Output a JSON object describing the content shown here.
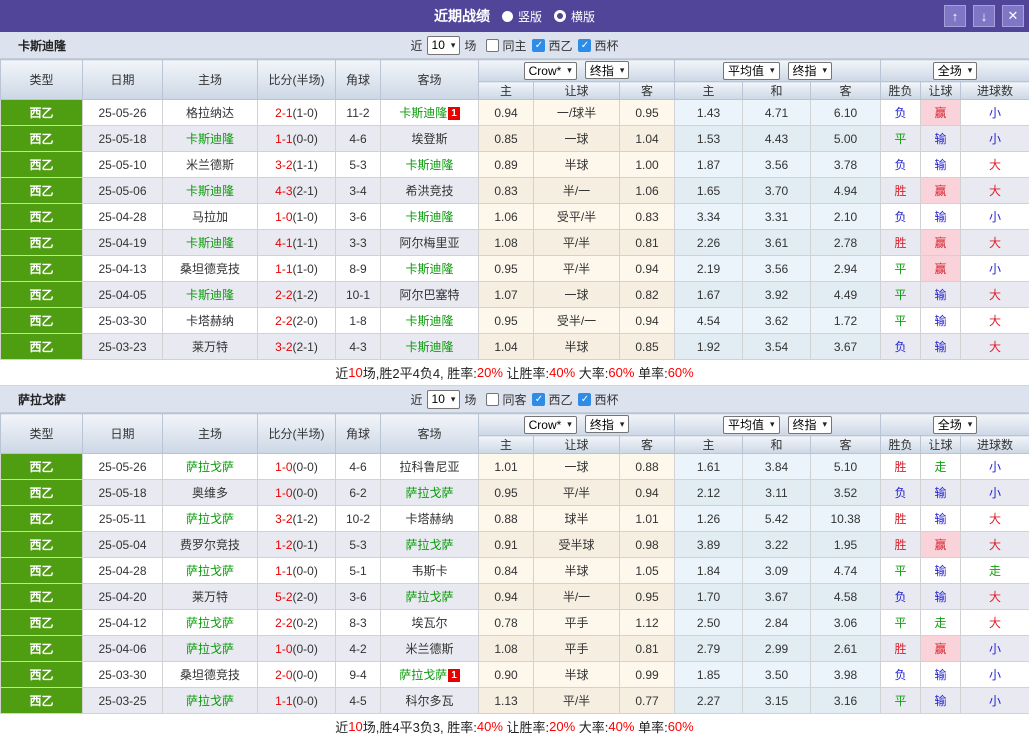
{
  "titlebar": {
    "title": "近期战绩",
    "radio_vertical": "竖版",
    "radio_horizontal": "横版"
  },
  "filter_labels": {
    "near": "近",
    "matches": "场",
    "league": "西乙",
    "cup": "西杯"
  },
  "columns": {
    "type": "类型",
    "date": "日期",
    "home": "主场",
    "score": "比分(半场)",
    "corner": "角球",
    "away": "客场",
    "crow_dropdown": "Crow*",
    "final_dropdown": "终指",
    "avg_dropdown": "平均值",
    "final2_dropdown": "终指",
    "full_dropdown": "全场",
    "sub": [
      "主",
      "让球",
      "客",
      "主",
      "和",
      "客",
      "胜负",
      "让球",
      "进球数"
    ]
  },
  "colors": {
    "accent_purple": "#51459a",
    "type_green": "#4f9d10",
    "subject_team_green": "#099b09",
    "score_red": "#e80000",
    "result_red": "#d9232e",
    "result_blue": "#2424d4",
    "result_green": "#12a012",
    "win_highlight_pink": "#fad3da",
    "checkbox_blue": "#2d8ce8"
  },
  "sections": [
    {
      "team": "卡斯迪隆",
      "count": "10",
      "same_venue": "同主",
      "rows": [
        {
          "league": "西乙",
          "date": "25-05-26",
          "home": "格拉纳达",
          "home_subject": false,
          "home_badge": "",
          "score": "2-1",
          "half": "(1-0)",
          "corner": "11-2",
          "away": "卡斯迪隆",
          "away_subject": true,
          "away_badge": "1",
          "crow": [
            "0.94",
            "一/球半",
            "0.95"
          ],
          "avg": [
            "1.43",
            "4.71",
            "6.10"
          ],
          "results": [
            {
              "t": "负",
              "c": "blue",
              "hl": false
            },
            {
              "t": "赢",
              "c": "red",
              "hl": true
            },
            {
              "t": "小",
              "c": "blue",
              "hl": false
            }
          ]
        },
        {
          "league": "西乙",
          "date": "25-05-18",
          "home": "卡斯迪隆",
          "home_subject": true,
          "home_badge": "",
          "score": "1-1",
          "half": "(0-0)",
          "corner": "4-6",
          "away": "埃登斯",
          "away_subject": false,
          "away_badge": "",
          "crow": [
            "0.85",
            "一球",
            "1.04"
          ],
          "avg": [
            "1.53",
            "4.43",
            "5.00"
          ],
          "results": [
            {
              "t": "平",
              "c": "green",
              "hl": false
            },
            {
              "t": "输",
              "c": "blue",
              "hl": false
            },
            {
              "t": "小",
              "c": "blue",
              "hl": false
            }
          ]
        },
        {
          "league": "西乙",
          "date": "25-05-10",
          "home": "米兰德斯",
          "home_subject": false,
          "home_badge": "",
          "score": "3-2",
          "half": "(1-1)",
          "corner": "5-3",
          "away": "卡斯迪隆",
          "away_subject": true,
          "away_badge": "",
          "crow": [
            "0.89",
            "半球",
            "1.00"
          ],
          "avg": [
            "1.87",
            "3.56",
            "3.78"
          ],
          "results": [
            {
              "t": "负",
              "c": "blue",
              "hl": false
            },
            {
              "t": "输",
              "c": "blue",
              "hl": false
            },
            {
              "t": "大",
              "c": "red",
              "hl": false
            }
          ]
        },
        {
          "league": "西乙",
          "date": "25-05-06",
          "home": "卡斯迪隆",
          "home_subject": true,
          "home_badge": "",
          "score": "4-3",
          "half": "(2-1)",
          "corner": "3-4",
          "away": "希洪竞技",
          "away_subject": false,
          "away_badge": "",
          "crow": [
            "0.83",
            "半/一",
            "1.06"
          ],
          "avg": [
            "1.65",
            "3.70",
            "4.94"
          ],
          "results": [
            {
              "t": "胜",
              "c": "red",
              "hl": false
            },
            {
              "t": "赢",
              "c": "red",
              "hl": true
            },
            {
              "t": "大",
              "c": "red",
              "hl": false
            }
          ]
        },
        {
          "league": "西乙",
          "date": "25-04-28",
          "home": "马拉加",
          "home_subject": false,
          "home_badge": "",
          "score": "1-0",
          "half": "(1-0)",
          "corner": "3-6",
          "away": "卡斯迪隆",
          "away_subject": true,
          "away_badge": "",
          "crow": [
            "1.06",
            "受平/半",
            "0.83"
          ],
          "avg": [
            "3.34",
            "3.31",
            "2.10"
          ],
          "results": [
            {
              "t": "负",
              "c": "blue",
              "hl": false
            },
            {
              "t": "输",
              "c": "blue",
              "hl": false
            },
            {
              "t": "小",
              "c": "blue",
              "hl": false
            }
          ]
        },
        {
          "league": "西乙",
          "date": "25-04-19",
          "home": "卡斯迪隆",
          "home_subject": true,
          "home_badge": "",
          "score": "4-1",
          "half": "(1-1)",
          "corner": "3-3",
          "away": "阿尔梅里亚",
          "away_subject": false,
          "away_badge": "",
          "crow": [
            "1.08",
            "平/半",
            "0.81"
          ],
          "avg": [
            "2.26",
            "3.61",
            "2.78"
          ],
          "results": [
            {
              "t": "胜",
              "c": "red",
              "hl": false
            },
            {
              "t": "赢",
              "c": "red",
              "hl": true
            },
            {
              "t": "大",
              "c": "red",
              "hl": false
            }
          ]
        },
        {
          "league": "西乙",
          "date": "25-04-13",
          "home": "桑坦德竞技",
          "home_subject": false,
          "home_badge": "",
          "score": "1-1",
          "half": "(1-0)",
          "corner": "8-9",
          "away": "卡斯迪隆",
          "away_subject": true,
          "away_badge": "",
          "crow": [
            "0.95",
            "平/半",
            "0.94"
          ],
          "avg": [
            "2.19",
            "3.56",
            "2.94"
          ],
          "results": [
            {
              "t": "平",
              "c": "green",
              "hl": false
            },
            {
              "t": "赢",
              "c": "red",
              "hl": true
            },
            {
              "t": "小",
              "c": "blue",
              "hl": false
            }
          ]
        },
        {
          "league": "西乙",
          "date": "25-04-05",
          "home": "卡斯迪隆",
          "home_subject": true,
          "home_badge": "",
          "score": "2-2",
          "half": "(1-2)",
          "corner": "10-1",
          "away": "阿尔巴塞特",
          "away_subject": false,
          "away_badge": "",
          "crow": [
            "1.07",
            "一球",
            "0.82"
          ],
          "avg": [
            "1.67",
            "3.92",
            "4.49"
          ],
          "results": [
            {
              "t": "平",
              "c": "green",
              "hl": false
            },
            {
              "t": "输",
              "c": "blue",
              "hl": false
            },
            {
              "t": "大",
              "c": "red",
              "hl": false
            }
          ]
        },
        {
          "league": "西乙",
          "date": "25-03-30",
          "home": "卡塔赫纳",
          "home_subject": false,
          "home_badge": "",
          "score": "2-2",
          "half": "(2-0)",
          "corner": "1-8",
          "away": "卡斯迪隆",
          "away_subject": true,
          "away_badge": "",
          "crow": [
            "0.95",
            "受半/一",
            "0.94"
          ],
          "avg": [
            "4.54",
            "3.62",
            "1.72"
          ],
          "results": [
            {
              "t": "平",
              "c": "green",
              "hl": false
            },
            {
              "t": "输",
              "c": "blue",
              "hl": false
            },
            {
              "t": "大",
              "c": "red",
              "hl": false
            }
          ]
        },
        {
          "league": "西乙",
          "date": "25-03-23",
          "home": "莱万特",
          "home_subject": false,
          "home_badge": "",
          "score": "3-2",
          "half": "(2-1)",
          "corner": "4-3",
          "away": "卡斯迪隆",
          "away_subject": true,
          "away_badge": "",
          "crow": [
            "1.04",
            "半球",
            "0.85"
          ],
          "avg": [
            "1.92",
            "3.54",
            "3.67"
          ],
          "results": [
            {
              "t": "负",
              "c": "blue",
              "hl": false
            },
            {
              "t": "输",
              "c": "blue",
              "hl": false
            },
            {
              "t": "大",
              "c": "red",
              "hl": false
            }
          ]
        }
      ],
      "summary": [
        [
          "近",
          "k"
        ],
        [
          "10",
          "r"
        ],
        [
          "场,胜2平4负4, 胜率:",
          "k"
        ],
        [
          "20%",
          "r"
        ],
        [
          " 让胜率:",
          "k"
        ],
        [
          "40%",
          "r"
        ],
        [
          " 大率:",
          "k"
        ],
        [
          "60%",
          "r"
        ],
        [
          " 单率:",
          "k"
        ],
        [
          "60%",
          "r"
        ]
      ]
    },
    {
      "team": "萨拉戈萨",
      "count": "10",
      "same_venue": "同客",
      "rows": [
        {
          "league": "西乙",
          "date": "25-05-26",
          "home": "萨拉戈萨",
          "home_subject": true,
          "home_badge": "",
          "score": "1-0",
          "half": "(0-0)",
          "corner": "4-6",
          "away": "拉科鲁尼亚",
          "away_subject": false,
          "away_badge": "",
          "crow": [
            "1.01",
            "一球",
            "0.88"
          ],
          "avg": [
            "1.61",
            "3.84",
            "5.10"
          ],
          "results": [
            {
              "t": "胜",
              "c": "red",
              "hl": false
            },
            {
              "t": "走",
              "c": "green",
              "hl": false
            },
            {
              "t": "小",
              "c": "blue",
              "hl": false
            }
          ]
        },
        {
          "league": "西乙",
          "date": "25-05-18",
          "home": "奥维多",
          "home_subject": false,
          "home_badge": "",
          "score": "1-0",
          "half": "(0-0)",
          "corner": "6-2",
          "away": "萨拉戈萨",
          "away_subject": true,
          "away_badge": "",
          "crow": [
            "0.95",
            "平/半",
            "0.94"
          ],
          "avg": [
            "2.12",
            "3.11",
            "3.52"
          ],
          "results": [
            {
              "t": "负",
              "c": "blue",
              "hl": false
            },
            {
              "t": "输",
              "c": "blue",
              "hl": false
            },
            {
              "t": "小",
              "c": "blue",
              "hl": false
            }
          ]
        },
        {
          "league": "西乙",
          "date": "25-05-11",
          "home": "萨拉戈萨",
          "home_subject": true,
          "home_badge": "",
          "score": "3-2",
          "half": "(1-2)",
          "corner": "10-2",
          "away": "卡塔赫纳",
          "away_subject": false,
          "away_badge": "",
          "crow": [
            "0.88",
            "球半",
            "1.01"
          ],
          "avg": [
            "1.26",
            "5.42",
            "10.38"
          ],
          "results": [
            {
              "t": "胜",
              "c": "red",
              "hl": false
            },
            {
              "t": "输",
              "c": "blue",
              "hl": false
            },
            {
              "t": "大",
              "c": "red",
              "hl": false
            }
          ]
        },
        {
          "league": "西乙",
          "date": "25-05-04",
          "home": "费罗尔竞技",
          "home_subject": false,
          "home_badge": "",
          "score": "1-2",
          "half": "(0-1)",
          "corner": "5-3",
          "away": "萨拉戈萨",
          "away_subject": true,
          "away_badge": "",
          "crow": [
            "0.91",
            "受半球",
            "0.98"
          ],
          "avg": [
            "3.89",
            "3.22",
            "1.95"
          ],
          "results": [
            {
              "t": "胜",
              "c": "red",
              "hl": false
            },
            {
              "t": "赢",
              "c": "red",
              "hl": true
            },
            {
              "t": "大",
              "c": "red",
              "hl": false
            }
          ]
        },
        {
          "league": "西乙",
          "date": "25-04-28",
          "home": "萨拉戈萨",
          "home_subject": true,
          "home_badge": "",
          "score": "1-1",
          "half": "(0-0)",
          "corner": "5-1",
          "away": "韦斯卡",
          "away_subject": false,
          "away_badge": "",
          "crow": [
            "0.84",
            "半球",
            "1.05"
          ],
          "avg": [
            "1.84",
            "3.09",
            "4.74"
          ],
          "results": [
            {
              "t": "平",
              "c": "green",
              "hl": false
            },
            {
              "t": "输",
              "c": "blue",
              "hl": false
            },
            {
              "t": "走",
              "c": "green",
              "hl": false
            }
          ]
        },
        {
          "league": "西乙",
          "date": "25-04-20",
          "home": "莱万特",
          "home_subject": false,
          "home_badge": "",
          "score": "5-2",
          "half": "(2-0)",
          "corner": "3-6",
          "away": "萨拉戈萨",
          "away_subject": true,
          "away_badge": "",
          "crow": [
            "0.94",
            "半/一",
            "0.95"
          ],
          "avg": [
            "1.70",
            "3.67",
            "4.58"
          ],
          "results": [
            {
              "t": "负",
              "c": "blue",
              "hl": false
            },
            {
              "t": "输",
              "c": "blue",
              "hl": false
            },
            {
              "t": "大",
              "c": "red",
              "hl": false
            }
          ]
        },
        {
          "league": "西乙",
          "date": "25-04-12",
          "home": "萨拉戈萨",
          "home_subject": true,
          "home_badge": "",
          "score": "2-2",
          "half": "(0-2)",
          "corner": "8-3",
          "away": "埃瓦尔",
          "away_subject": false,
          "away_badge": "",
          "crow": [
            "0.78",
            "平手",
            "1.12"
          ],
          "avg": [
            "2.50",
            "2.84",
            "3.06"
          ],
          "results": [
            {
              "t": "平",
              "c": "green",
              "hl": false
            },
            {
              "t": "走",
              "c": "green",
              "hl": false
            },
            {
              "t": "大",
              "c": "red",
              "hl": false
            }
          ]
        },
        {
          "league": "西乙",
          "date": "25-04-06",
          "home": "萨拉戈萨",
          "home_subject": true,
          "home_badge": "",
          "score": "1-0",
          "half": "(0-0)",
          "corner": "4-2",
          "away": "米兰德斯",
          "away_subject": false,
          "away_badge": "",
          "crow": [
            "1.08",
            "平手",
            "0.81"
          ],
          "avg": [
            "2.79",
            "2.99",
            "2.61"
          ],
          "results": [
            {
              "t": "胜",
              "c": "red",
              "hl": false
            },
            {
              "t": "赢",
              "c": "red",
              "hl": true
            },
            {
              "t": "小",
              "c": "blue",
              "hl": false
            }
          ]
        },
        {
          "league": "西乙",
          "date": "25-03-30",
          "home": "桑坦德竞技",
          "home_subject": false,
          "home_badge": "",
          "score": "2-0",
          "half": "(0-0)",
          "corner": "9-4",
          "away": "萨拉戈萨",
          "away_subject": true,
          "away_badge": "1",
          "crow": [
            "0.90",
            "半球",
            "0.99"
          ],
          "avg": [
            "1.85",
            "3.50",
            "3.98"
          ],
          "results": [
            {
              "t": "负",
              "c": "blue",
              "hl": false
            },
            {
              "t": "输",
              "c": "blue",
              "hl": false
            },
            {
              "t": "小",
              "c": "blue",
              "hl": false
            }
          ]
        },
        {
          "league": "西乙",
          "date": "25-03-25",
          "home": "萨拉戈萨",
          "home_subject": true,
          "home_badge": "",
          "score": "1-1",
          "half": "(0-0)",
          "corner": "4-5",
          "away": "科尔多瓦",
          "away_subject": false,
          "away_badge": "",
          "crow": [
            "1.13",
            "平/半",
            "0.77"
          ],
          "avg": [
            "2.27",
            "3.15",
            "3.16"
          ],
          "results": [
            {
              "t": "平",
              "c": "green",
              "hl": false
            },
            {
              "t": "输",
              "c": "blue",
              "hl": false
            },
            {
              "t": "小",
              "c": "blue",
              "hl": false
            }
          ]
        }
      ],
      "summary": [
        [
          "近",
          "k"
        ],
        [
          "10",
          "r"
        ],
        [
          "场,胜4平3负3, 胜率:",
          "k"
        ],
        [
          "40%",
          "r"
        ],
        [
          " 让胜率:",
          "k"
        ],
        [
          "20%",
          "r"
        ],
        [
          " 大率:",
          "k"
        ],
        [
          "40%",
          "r"
        ],
        [
          " 单率:",
          "k"
        ],
        [
          "60%",
          "r"
        ]
      ]
    }
  ]
}
